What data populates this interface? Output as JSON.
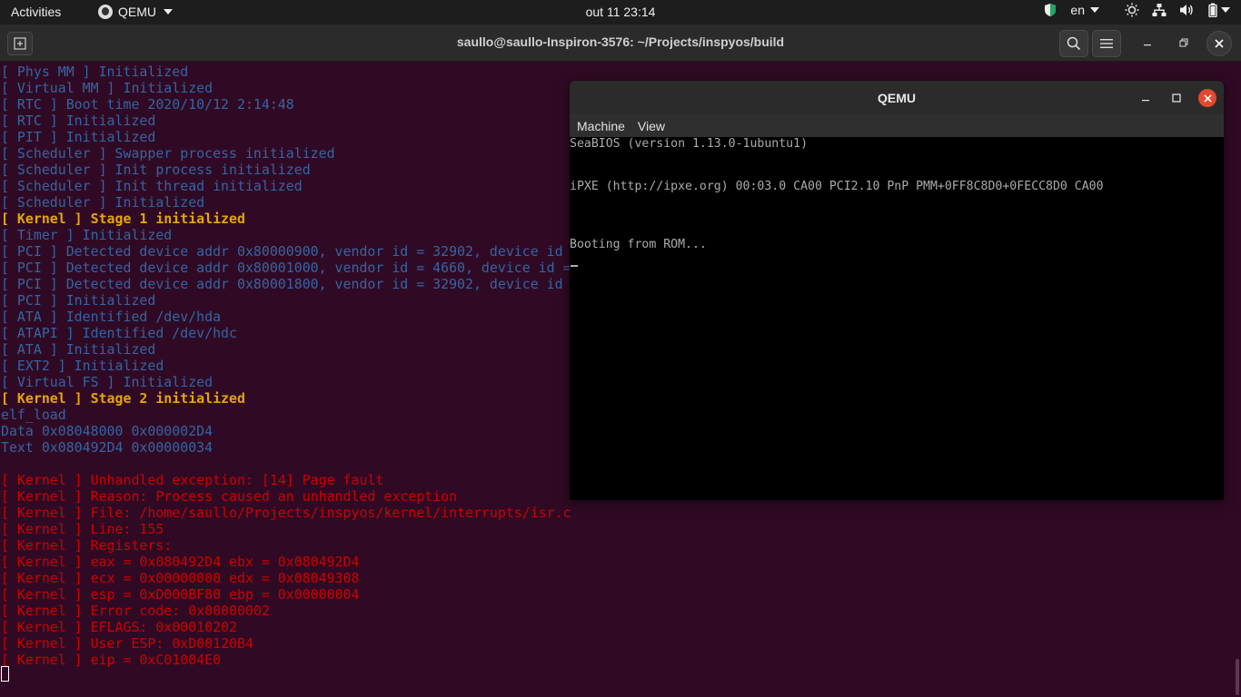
{
  "topbar": {
    "activities": "Activities",
    "app_name": "QEMU",
    "clock": "out 11  23:14",
    "lang": "en"
  },
  "terminal": {
    "title": "saullo@saullo-Inspiron-3576: ~/Projects/inspyos/build",
    "lines": [
      {
        "text": "[ Phys MM ] Initialized",
        "color": "blue"
      },
      {
        "text": "[ Virtual MM ] Initialized",
        "color": "blue"
      },
      {
        "text": "[ RTC ] Boot time 2020/10/12 2:14:48",
        "color": "blue"
      },
      {
        "text": "[ RTC ] Initialized",
        "color": "blue"
      },
      {
        "text": "[ PIT ] Initialized",
        "color": "blue"
      },
      {
        "text": "[ Scheduler ] Swapper process initialized",
        "color": "blue"
      },
      {
        "text": "[ Scheduler ] Init process initialized",
        "color": "blue"
      },
      {
        "text": "[ Scheduler ] Init thread initialized",
        "color": "blue"
      },
      {
        "text": "[ Scheduler ] Initialized",
        "color": "blue"
      },
      {
        "text": "[ Kernel ] Stage 1 initialized",
        "color": "yellow"
      },
      {
        "text": "[ Timer ] Initialized",
        "color": "blue"
      },
      {
        "text": "[ PCI ] Detected device addr 0x80000900, vendor id = 32902, device id",
        "color": "blue"
      },
      {
        "text": "[ PCI ] Detected device addr 0x80001000, vendor id = 4660, device id =",
        "color": "blue"
      },
      {
        "text": "[ PCI ] Detected device addr 0x80001800, vendor id = 32902, device id",
        "color": "blue"
      },
      {
        "text": "[ PCI ] Initialized",
        "color": "blue"
      },
      {
        "text": "[ ATA ] Identified /dev/hda",
        "color": "blue"
      },
      {
        "text": "[ ATAPI ] Identified /dev/hdc",
        "color": "blue"
      },
      {
        "text": "[ ATA ] Initialized",
        "color": "blue"
      },
      {
        "text": "[ EXT2 ] Initialized",
        "color": "blue"
      },
      {
        "text": "[ Virtual FS ] Initialized",
        "color": "blue"
      },
      {
        "text": "[ Kernel ] Stage 2 initialized",
        "color": "yellow"
      },
      {
        "text": "elf_load",
        "color": "blue"
      },
      {
        "text": "Data 0x08048000 0x000002D4",
        "color": "blue"
      },
      {
        "text": "Text 0x080492D4 0x00000034",
        "color": "blue"
      },
      {
        "text": "",
        "color": "blue"
      },
      {
        "text": "[ Kernel ] Unhandled exception: [14] Page fault",
        "color": "red"
      },
      {
        "text": "[ Kernel ] Reason: Process caused an unhandled exception",
        "color": "red"
      },
      {
        "text": "[ Kernel ] File: /home/saullo/Projects/inspyos/kernel/interrupts/isr.c",
        "color": "red"
      },
      {
        "text": "[ Kernel ] Line: 155",
        "color": "red"
      },
      {
        "text": "[ Kernel ] Registers:",
        "color": "red"
      },
      {
        "text": "[ Kernel ] eax = 0x080492D4 ebx = 0x080492D4",
        "color": "red"
      },
      {
        "text": "[ Kernel ] ecx = 0x00000000 edx = 0x08049308",
        "color": "red"
      },
      {
        "text": "[ Kernel ] esp = 0xD000BF80 ebp = 0x00000004",
        "color": "red"
      },
      {
        "text": "[ Kernel ] Error code: 0x00000002",
        "color": "red"
      },
      {
        "text": "[ Kernel ] EFLAGS: 0x00010202",
        "color": "red"
      },
      {
        "text": "[ Kernel ] User ESP: 0xD00120B4",
        "color": "red"
      },
      {
        "text": "[ Kernel ] eip = 0xC01004E0",
        "color": "red"
      }
    ]
  },
  "qemu": {
    "title": "QEMU",
    "menu": [
      "Machine",
      "View"
    ],
    "screen_lines": [
      "SeaBIOS (version 1.13.0-1ubuntu1)",
      "iPXE (http://ipxe.org) 00:03.0 CA00 PCI2.10 PnP PMM+0FF8C8D0+0FECC8D0 CA00",
      "Booting from ROM..."
    ]
  },
  "colors": {
    "terminal_bg": "#300a24",
    "blue": "#3465a4",
    "yellow": "#e5a50a",
    "red": "#cc0000",
    "close_button": "#e2492f"
  }
}
